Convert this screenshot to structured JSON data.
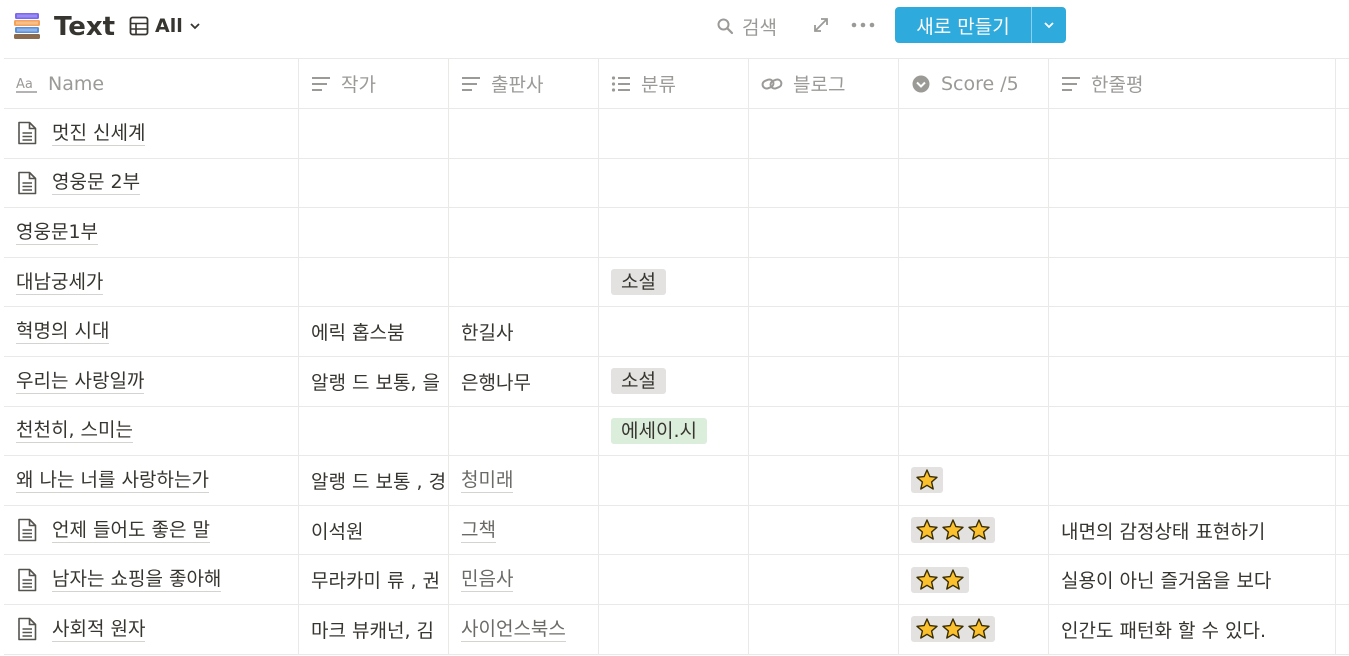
{
  "header": {
    "title": "Text",
    "view_label": "All",
    "search_label": "검색",
    "new_button_label": "새로 만들기",
    "accent_color": "#2eaadc"
  },
  "columns": [
    {
      "label": "Name",
      "icon": "title-aa-icon"
    },
    {
      "label": "작가",
      "icon": "text-lines-icon"
    },
    {
      "label": "출판사",
      "icon": "text-lines-icon"
    },
    {
      "label": "분류",
      "icon": "list-icon"
    },
    {
      "label": "블로그",
      "icon": "link-icon"
    },
    {
      "label": "Score /5",
      "icon": "select-circle-icon"
    },
    {
      "label": "한줄평",
      "icon": "text-lines-icon"
    }
  ],
  "rows": [
    {
      "name": "멋진 신세계",
      "page_icon": true,
      "author": "",
      "publisher": "",
      "category": "",
      "category_color": "",
      "blog": "",
      "stars": 0,
      "review": ""
    },
    {
      "name": "영웅문 2부",
      "page_icon": true,
      "author": "",
      "publisher": "",
      "category": "",
      "category_color": "",
      "blog": "",
      "stars": 0,
      "review": ""
    },
    {
      "name": "영웅문1부",
      "page_icon": false,
      "author": "",
      "publisher": "",
      "category": "",
      "category_color": "",
      "blog": "",
      "stars": 0,
      "review": ""
    },
    {
      "name": "대남궁세가",
      "page_icon": false,
      "author": "",
      "publisher": "",
      "category": "소설",
      "category_color": "#e3e2e0",
      "blog": "",
      "stars": 0,
      "review": ""
    },
    {
      "name": "혁명의 시대",
      "page_icon": false,
      "author": "에릭 홉스붐",
      "publisher": "한길사",
      "publisher_link": false,
      "category": "",
      "category_color": "",
      "blog": "",
      "stars": 0,
      "review": ""
    },
    {
      "name": "우리는 사랑일까",
      "page_icon": false,
      "author": "알랭 드 보통, 을",
      "publisher": "은행나무",
      "publisher_link": false,
      "category": "소설",
      "category_color": "#e3e2e0",
      "blog": "",
      "stars": 0,
      "review": ""
    },
    {
      "name": "천천히, 스미는",
      "page_icon": false,
      "author": "",
      "publisher": "",
      "category": "에세이.시",
      "category_color": "#dbeddb",
      "blog": "",
      "stars": 0,
      "review": ""
    },
    {
      "name": "왜 나는 너를 사랑하는가",
      "page_icon": false,
      "author": "알랭 드 보통 , 경",
      "publisher": "청미래",
      "publisher_link": true,
      "category": "",
      "category_color": "",
      "blog": "",
      "stars": 1,
      "review": ""
    },
    {
      "name": "언제 들어도 좋은 말",
      "page_icon": true,
      "author": "이석원",
      "publisher": "그책",
      "publisher_link": true,
      "category": "",
      "category_color": "",
      "blog": "",
      "stars": 3,
      "review": "내면의 감정상태 표현하기"
    },
    {
      "name": "남자는 쇼핑을 좋아해",
      "page_icon": true,
      "author": "무라카미 류 , 권",
      "publisher": "민음사",
      "publisher_link": true,
      "category": "",
      "category_color": "",
      "blog": "",
      "stars": 2,
      "review": "실용이 아닌 즐거움을 보다"
    },
    {
      "name": "사회적 원자",
      "page_icon": true,
      "author": "마크 뷰캐넌, 김",
      "publisher": "사이언스북스",
      "publisher_link": true,
      "category": "",
      "category_color": "",
      "blog": "",
      "stars": 3,
      "review": "인간도 패턴화 할 수 있다."
    }
  ]
}
